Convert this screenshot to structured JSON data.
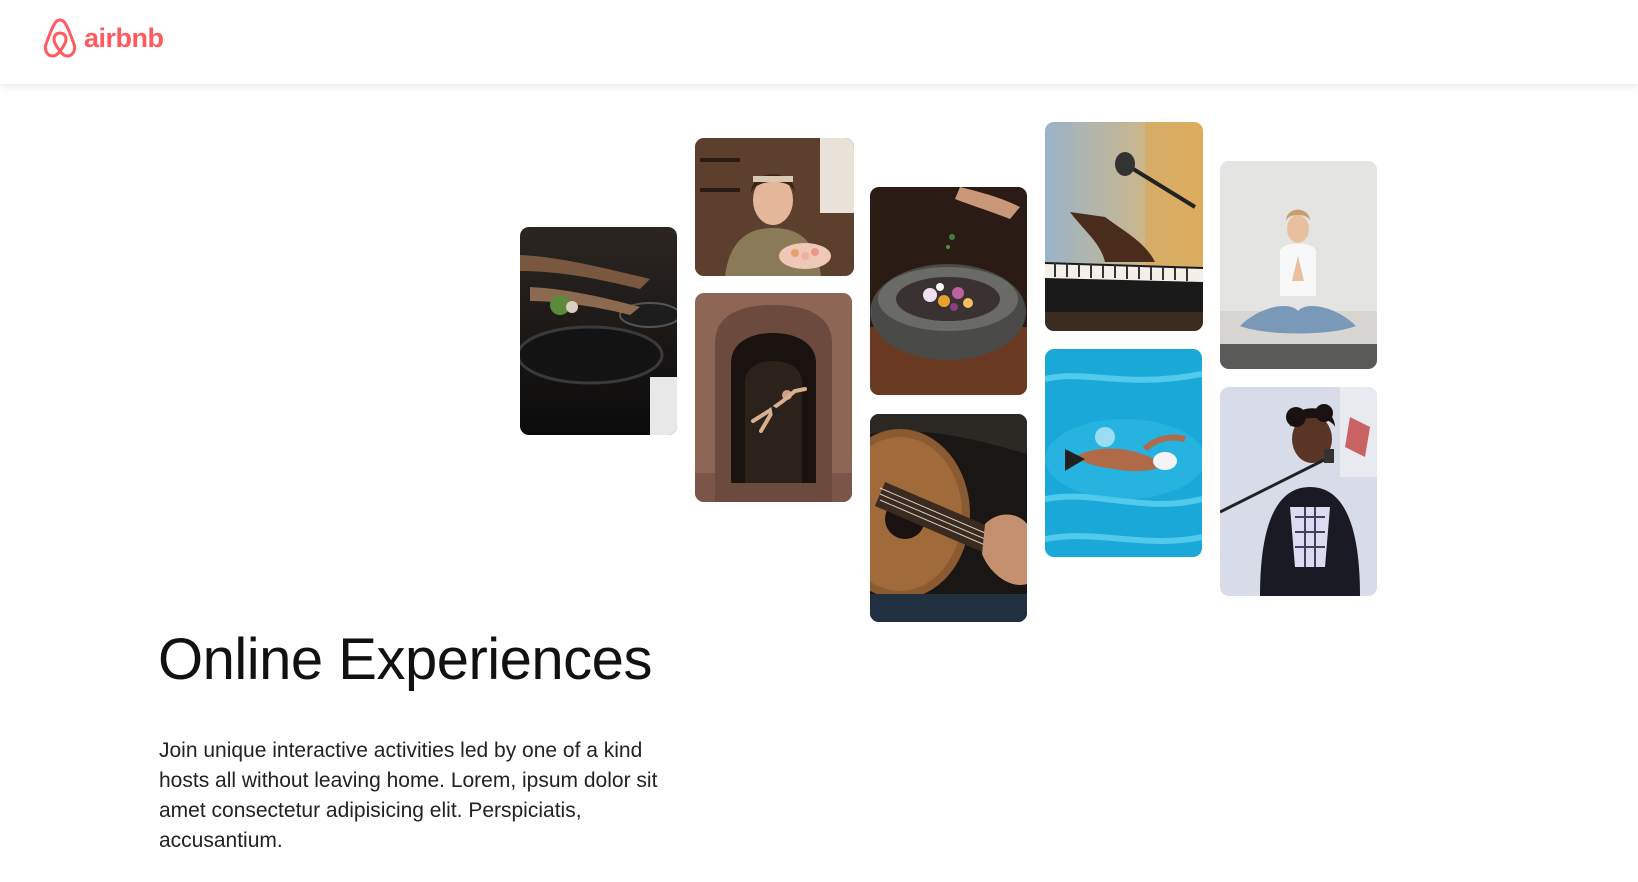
{
  "brand": {
    "name": "airbnb",
    "color": "#FF5A5F",
    "icon": "airbnb-logo-icon"
  },
  "hero": {
    "title": "Online Experiences",
    "description": "Join unique interactive activities led by one of a kind hosts all without leaving home. Lorem, ipsum dolor sit amet consectetur adipisicing elit. Perspiciatis, accusantium."
  },
  "gallery": [
    {
      "id": "cooking-pans",
      "subject": "hands cooking with frying pans"
    },
    {
      "id": "baker",
      "subject": "smiling woman holding tray of macarons"
    },
    {
      "id": "dancer",
      "subject": "dancer leaping in an ornate archway"
    },
    {
      "id": "food-bowl",
      "subject": "chef seasoning a stone bowl of food"
    },
    {
      "id": "guitar",
      "subject": "hands playing an acoustic guitar"
    },
    {
      "id": "piano",
      "subject": "hands on a keyboard with a microphone"
    },
    {
      "id": "swimmer",
      "subject": "swimmer in a blue pool"
    },
    {
      "id": "yoga",
      "subject": "woman meditating in lotus pose"
    },
    {
      "id": "singer",
      "subject": "person singing into a microphone"
    }
  ]
}
